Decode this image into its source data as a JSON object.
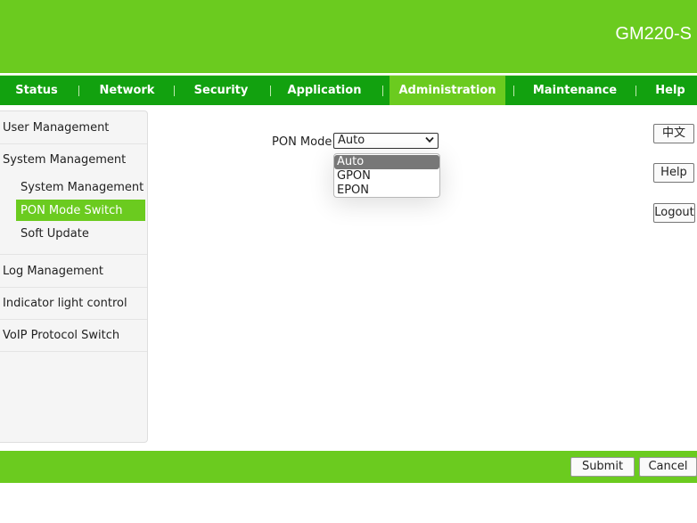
{
  "header": {
    "model": "GM220-S"
  },
  "nav": {
    "tabs": [
      {
        "label": "Status"
      },
      {
        "label": "Network"
      },
      {
        "label": "Security"
      },
      {
        "label": "Application"
      },
      {
        "label": "Administration",
        "active": true
      },
      {
        "label": "Maintenance"
      },
      {
        "label": "Help"
      }
    ]
  },
  "sidebar": {
    "items": [
      {
        "label": "User Management"
      },
      {
        "label": "System Management"
      },
      {
        "label": "Log Management"
      },
      {
        "label": "Indicator light control"
      },
      {
        "label": "VoIP Protocol Switch"
      }
    ],
    "subitems": [
      {
        "label": "System Management"
      },
      {
        "label": "PON Mode Switch",
        "active": true
      },
      {
        "label": "Soft Update"
      }
    ]
  },
  "main": {
    "pon_mode_label": "PON Mode",
    "pon_mode_value": "Auto",
    "options": [
      "Auto",
      "GPON",
      "EPON"
    ]
  },
  "right_buttons": {
    "language": "中文",
    "help": "Help",
    "logout": "Logout"
  },
  "footer": {
    "submit": "Submit",
    "cancel": "Cancel"
  },
  "colors": {
    "header_green": "#6bcb1f",
    "nav_green": "#12a10f"
  },
  "icons": {
    "select_arrow": "chevron-down-icon"
  }
}
